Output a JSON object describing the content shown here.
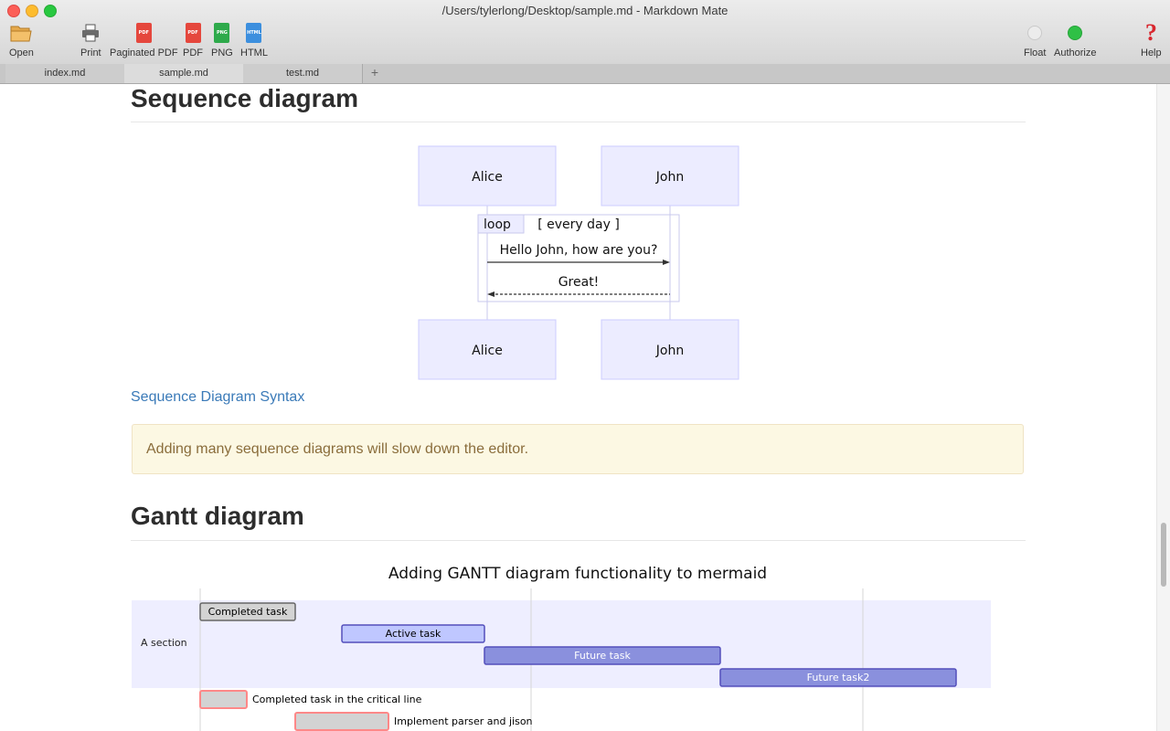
{
  "window": {
    "title": "/Users/tylerlong/Desktop/sample.md - Markdown Mate"
  },
  "toolbar": {
    "open": "Open",
    "print": "Print",
    "paginated_pdf": "Paginated PDF",
    "pdf": "PDF",
    "png": "PNG",
    "html": "HTML",
    "float": "Float",
    "authorize": "Authorize",
    "help": "Help",
    "icon_pdf": "PDF",
    "icon_png": "PNG",
    "icon_html": "HTML",
    "help_glyph": "?"
  },
  "tabs": [
    {
      "label": "index.md"
    },
    {
      "label": "sample.md"
    },
    {
      "label": "test.md"
    }
  ],
  "tab_add": "+",
  "sequence": {
    "heading": "Sequence diagram",
    "actors": [
      "Alice",
      "John"
    ],
    "loop_label": "loop",
    "loop_condition": "[ every day ]",
    "messages": [
      "Hello John, how are you?",
      "Great!"
    ],
    "link": "Sequence Diagram Syntax",
    "warning": "Adding many sequence diagrams will slow down the editor."
  },
  "gantt": {
    "heading": "Gantt diagram",
    "title": "Adding GANTT diagram functionality to mermaid",
    "section": "A section",
    "tasks": [
      "Completed task",
      "Active task",
      "Future task",
      "Future task2",
      "Completed task in the critical line",
      "Implement parser and jison"
    ]
  },
  "colors": {
    "actor_fill": "#ececff",
    "actor_stroke": "#ccccff",
    "link": "#3a7ab8",
    "warning_bg": "#fcf8e3",
    "warning_text": "#8a6d3b",
    "authorize_dot": "#2fc046"
  }
}
